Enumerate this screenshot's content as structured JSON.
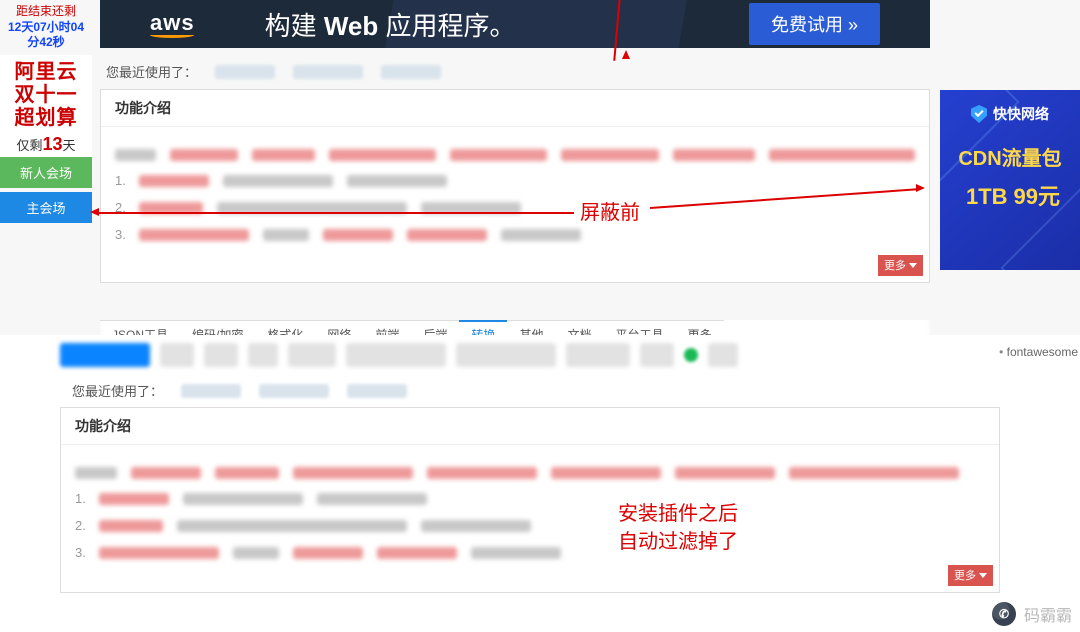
{
  "countdown": {
    "label": "距结束还剩",
    "time": "12天07小时04分42秒"
  },
  "promo": {
    "l1": "阿里云",
    "l2": "双十一",
    "l3": "超划算",
    "remain_prefix": "仅剩",
    "remain_days": "13",
    "remain_suffix": "天",
    "btn_new": "新人会场",
    "btn_main": "主会场"
  },
  "aws": {
    "logo": "aws",
    "title_pre": "构建 ",
    "title_bold": "Web",
    "title_post": " 应用程序。",
    "cta": "免费试用 »"
  },
  "recent_label": "您最近使用了：",
  "card": {
    "head": "功能介绍",
    "more": "更多"
  },
  "cdn": {
    "brand": "快快网络",
    "line1": "CDN流量包",
    "line2a": "1TB",
    "line2b": "99元"
  },
  "anno_before": "屏蔽前",
  "tabs": [
    "JSON工具",
    "编码/加密",
    "格式化",
    "网络",
    "前端",
    "后端",
    "转换",
    "其他",
    "文档",
    "平台工具",
    "更多"
  ],
  "tabs_active_index": 6,
  "fontawesome": "fontawesome",
  "anno_after_l1": "安装插件之后",
  "anno_after_l2": "自动过滤掉了",
  "watermark": "码霸霸"
}
